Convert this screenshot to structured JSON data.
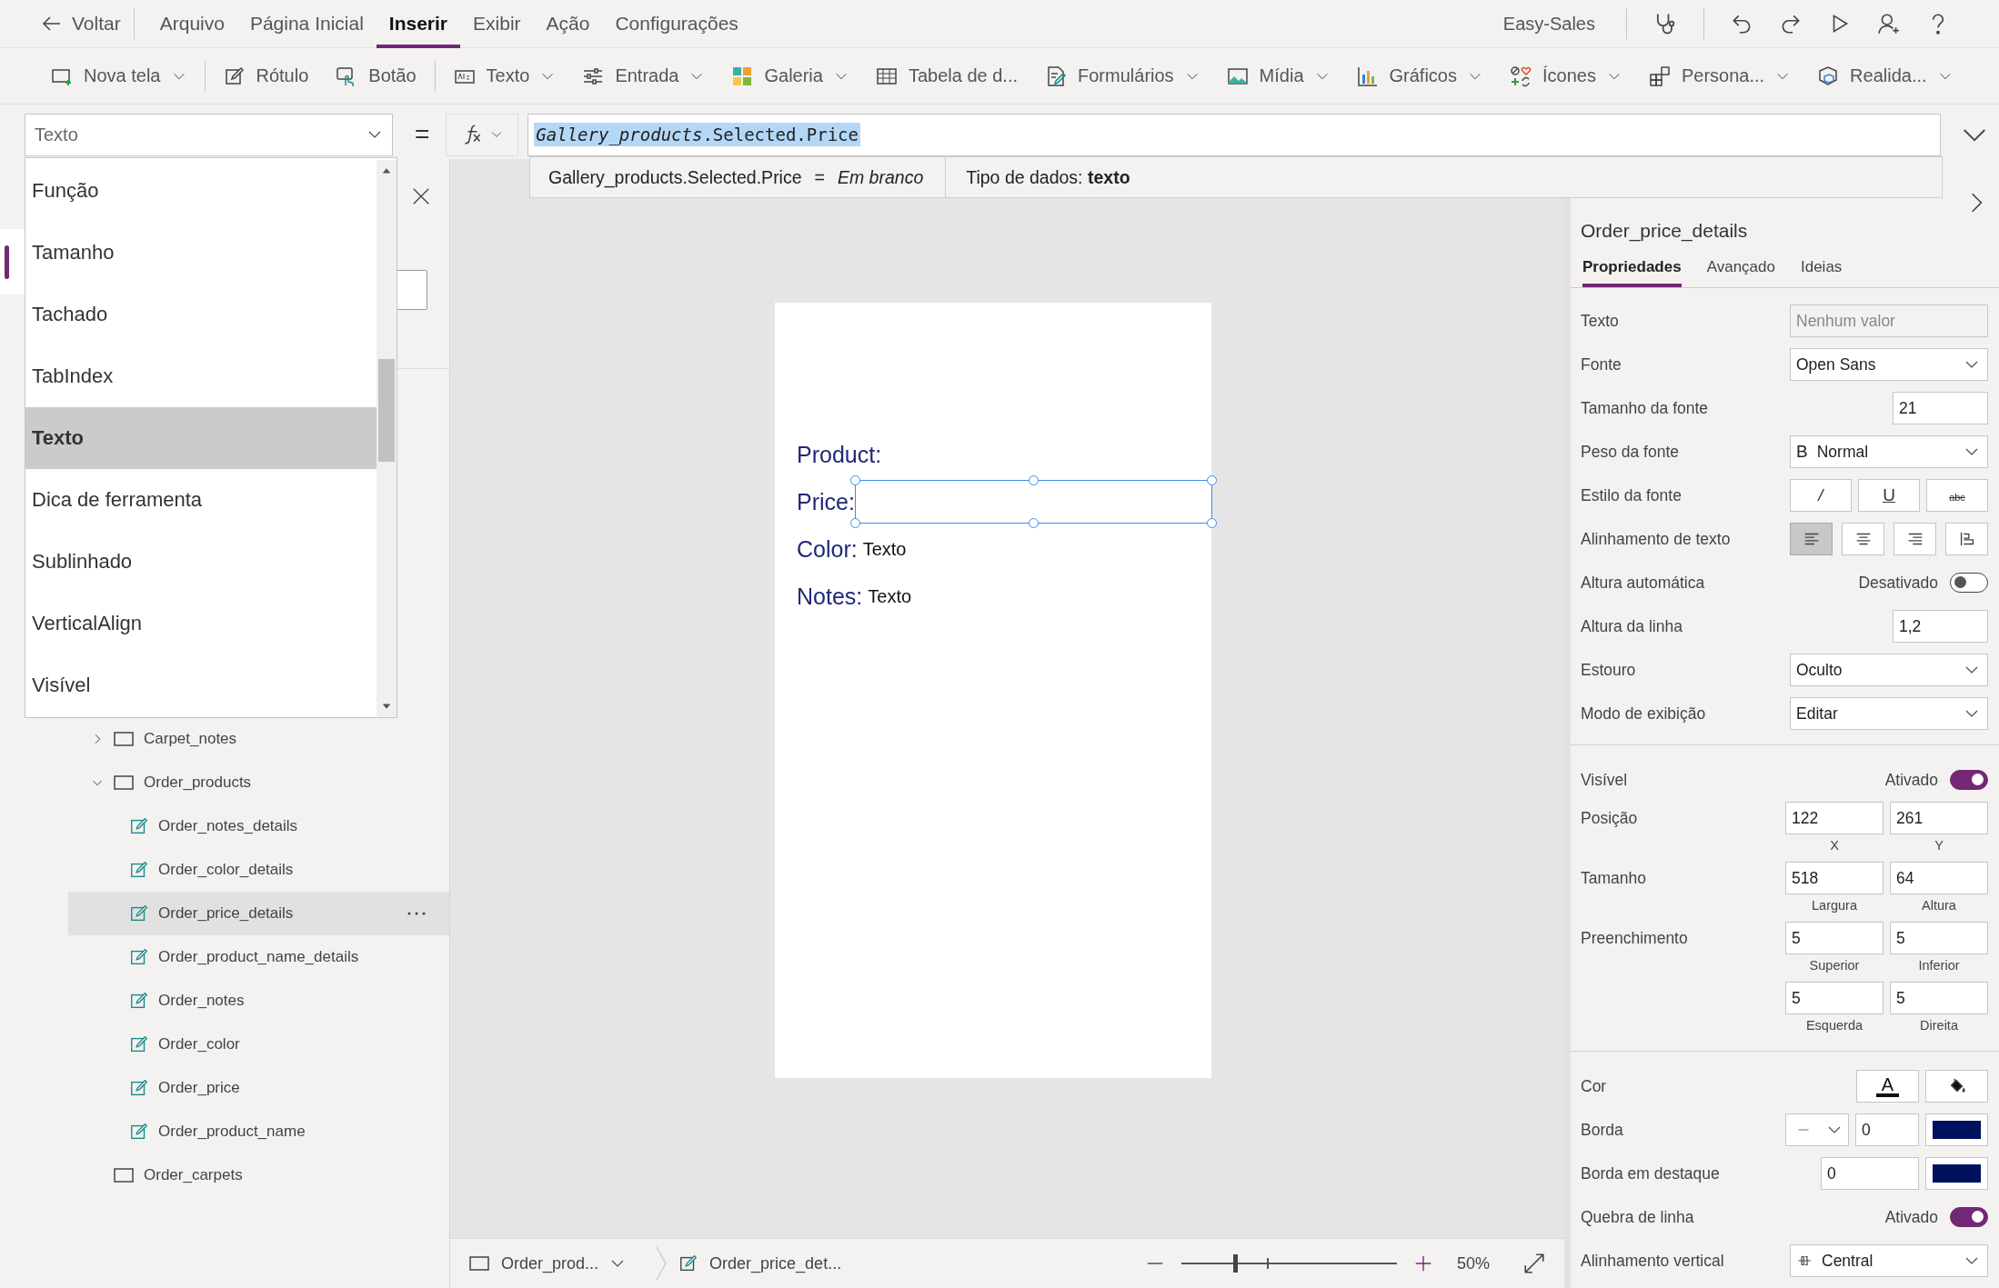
{
  "menu_bar": {
    "back": "Voltar",
    "tabs": [
      {
        "label": "Arquivo",
        "selected": false
      },
      {
        "label": "Página Inicial",
        "selected": false
      },
      {
        "label": "Inserir",
        "selected": true
      },
      {
        "label": "Exibir",
        "selected": false
      },
      {
        "label": "Ação",
        "selected": false
      },
      {
        "label": "Configurações",
        "selected": false
      }
    ],
    "app_name": "Easy-Sales"
  },
  "toolbar": [
    {
      "label": "Nova tela",
      "dropdown": true
    },
    {
      "label": "Rótulo",
      "dropdown": false
    },
    {
      "label": "Botão",
      "dropdown": false
    },
    {
      "label": "Texto",
      "dropdown": true
    },
    {
      "label": "Entrada",
      "dropdown": true
    },
    {
      "label": "Galeria",
      "dropdown": true
    },
    {
      "label": "Tabela de d...",
      "dropdown": false
    },
    {
      "label": "Formulários",
      "dropdown": true
    },
    {
      "label": "Mídia",
      "dropdown": true
    },
    {
      "label": "Gráficos",
      "dropdown": true
    },
    {
      "label": "Ícones",
      "dropdown": true
    },
    {
      "label": "Persona...",
      "dropdown": true
    },
    {
      "label": "Realida...",
      "dropdown": true
    }
  ],
  "formula_bar": {
    "property": "Texto",
    "operator": "=",
    "formula": "*Gallery_products*.Selected.Price"
  },
  "formula_hint": {
    "expression": "Gallery_products.Selected.Price",
    "operator": "=",
    "result": "Em branco",
    "data_type": "Tipo de dados: **texto**"
  },
  "property_list": [
    {
      "label": "Função",
      "selected": false
    },
    {
      "label": "Tamanho",
      "selected": false
    },
    {
      "label": "Tachado",
      "selected": false
    },
    {
      "label": "TabIndex",
      "selected": false
    },
    {
      "label": "Texto",
      "selected": true
    },
    {
      "label": "Dica de ferramenta",
      "selected": false
    },
    {
      "label": "Sublinhado",
      "selected": false
    },
    {
      "label": "VerticalAlign",
      "selected": false
    },
    {
      "label": "Visível",
      "selected": false
    }
  ],
  "tree": [
    {
      "name": "Carpet_notes",
      "kind": "screen",
      "expanded": false,
      "selected": false
    },
    {
      "name": "Order_products",
      "kind": "screen",
      "expanded": true,
      "selected": false,
      "children": [
        {
          "name": "Order_notes_details",
          "kind": "label",
          "selected": false
        },
        {
          "name": "Order_color_details",
          "kind": "label",
          "selected": false
        },
        {
          "name": "Order_price_details",
          "kind": "label",
          "selected": true
        },
        {
          "name": "Order_product_name_details",
          "kind": "label",
          "selected": false
        },
        {
          "name": "Order_notes",
          "kind": "label",
          "selected": false
        },
        {
          "name": "Order_color",
          "kind": "label",
          "selected": false
        },
        {
          "name": "Order_price",
          "kind": "label",
          "selected": false
        },
        {
          "name": "Order_product_name",
          "kind": "label",
          "selected": false
        }
      ]
    },
    {
      "name": "Order_carpets",
      "kind": "screen",
      "selected": false
    }
  ],
  "canvas": {
    "fields": [
      {
        "label": "Product:",
        "selected": false
      },
      {
        "label": "Price:",
        "selected": true
      },
      {
        "label": "Color:",
        "value": "Texto",
        "selected": false
      },
      {
        "label": "Notes:",
        "value": "Texto",
        "selected": false
      }
    ]
  },
  "properties_panel": {
    "control_name": "Order_price_details",
    "tabs": [
      {
        "label": "Propriedades",
        "selected": true
      },
      {
        "label": "Avançado",
        "selected": false
      },
      {
        "label": "Ideias",
        "selected": false
      }
    ],
    "sections": [
      [
        {
          "label": "Texto",
          "kind": "input",
          "placeholder": "Nenhum valor"
        },
        {
          "label": "Fonte",
          "kind": "dropdown",
          "value": "Open Sans"
        },
        {
          "label": "Tamanho da fonte",
          "kind": "number",
          "value": "21"
        },
        {
          "label": "Peso da fonte",
          "kind": "dropdown",
          "prefix": "B",
          "value": "Normal"
        },
        {
          "label": "Estilo da fonte",
          "kind": "style",
          "options": [
            {
              "text": "/",
              "selected": false
            },
            {
              "text": "U",
              "selected": false
            },
            {
              "text": "abc",
              "selected": false
            }
          ]
        },
        {
          "label": "Alinhamento de texto",
          "kind": "align",
          "options": [
            {
              "selected": true
            },
            {
              "selected": false
            },
            {
              "selected": false
            },
            {
              "selected": false
            }
          ]
        },
        {
          "label": "Altura automática",
          "kind": "toggle",
          "state_label": "Desativado",
          "on": false
        },
        {
          "label": "Altura da linha",
          "kind": "number",
          "value": "1,2"
        },
        {
          "label": "Estouro",
          "kind": "dropdown",
          "value": "Oculto"
        },
        {
          "label": "Modo de exibição",
          "kind": "dropdown",
          "value": "Editar"
        }
      ],
      [
        {
          "label": "Visível",
          "kind": "toggle",
          "state_label": "Ativado",
          "on": true
        },
        {
          "label": "Posição",
          "kind": "pair",
          "fields": [
            {
              "value": "122",
              "caption": "X"
            },
            {
              "value": "261",
              "caption": "Y"
            }
          ]
        },
        {
          "label": "Tamanho",
          "kind": "pair",
          "fields": [
            {
              "value": "518",
              "caption": "Largura"
            },
            {
              "value": "64",
              "caption": "Altura"
            }
          ]
        },
        {
          "label": "Preenchimento",
          "kind": "pair",
          "fields": [
            {
              "value": "5",
              "caption": "Superior"
            },
            {
              "value": "5",
              "caption": "Inferior"
            }
          ]
        },
        {
          "kind": "pair",
          "fields": [
            {
              "value": "5",
              "caption": "Esquerda"
            },
            {
              "value": "5",
              "caption": "Direita"
            }
          ]
        }
      ],
      [
        {
          "label": "Cor",
          "kind": "color-buttons",
          "letter": "A"
        },
        {
          "label": "Borda",
          "kind": "border",
          "style_picker": true,
          "value": "0",
          "color": "#00125e"
        },
        {
          "label": "Borda em destaque",
          "kind": "border",
          "style_picker": false,
          "value": "0",
          "color": "#00125e"
        },
        {
          "label": "Quebra de linha",
          "kind": "toggle",
          "state_label": "Ativado",
          "on": true
        },
        {
          "label": "Alinhamento vertical",
          "kind": "dropdown-icon",
          "value": "Central"
        }
      ]
    ]
  },
  "status_bar": {
    "screen": "Order_prod...",
    "control": "Order_price_det...",
    "zoom": {
      "level": 0.25
    },
    "zoom_label": "50%"
  }
}
